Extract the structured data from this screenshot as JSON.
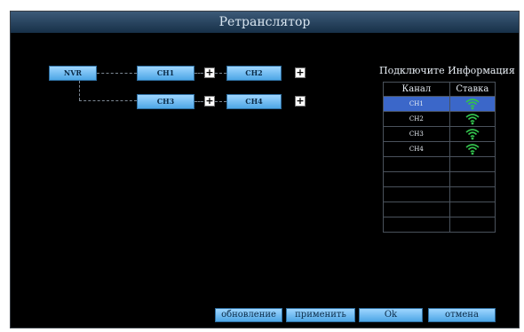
{
  "window": {
    "title": "Ретранслятор"
  },
  "topology": {
    "nvr_label": "NVR",
    "channels": [
      "CH1",
      "CH2",
      "CH3",
      "CH4"
    ],
    "add_symbol": "+"
  },
  "info_panel": {
    "title": "Подключите Информация",
    "headers": {
      "channel": "Канал",
      "rate": "Ставка"
    },
    "rows": [
      {
        "channel": "CH1",
        "signal_icon": "wifi-signal-icon",
        "selected": true
      },
      {
        "channel": "CH2",
        "signal_icon": "wifi-signal-icon",
        "selected": false
      },
      {
        "channel": "CH3",
        "signal_icon": "wifi-signal-icon",
        "selected": false
      },
      {
        "channel": "CH4",
        "signal_icon": "wifi-signal-icon",
        "selected": false
      }
    ],
    "empty_rows": 5
  },
  "buttons": {
    "refresh": "обновление",
    "apply": "применить",
    "ok": "Ok",
    "cancel": "отмена"
  },
  "colors": {
    "background": "#000000",
    "accent_button": "#4da6e6",
    "selection": "#3b67c9",
    "signal": "#33c24d"
  }
}
